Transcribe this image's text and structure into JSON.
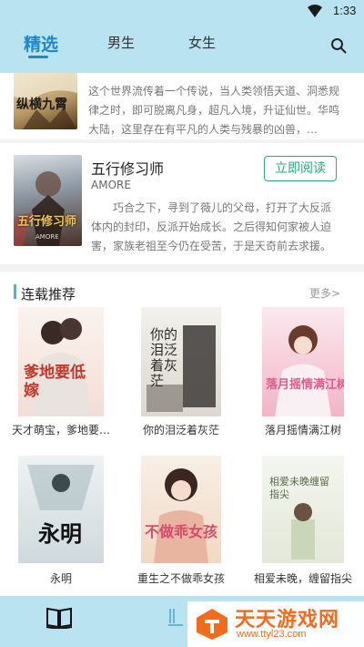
{
  "status": {
    "time": "1:33"
  },
  "tabs": [
    {
      "label": "精选"
    },
    {
      "label": "男生"
    },
    {
      "label": "女生"
    }
  ],
  "featured": [
    {
      "cover_text": "纵横九霄",
      "description": "这个世界流传着一个传说，当人类领悟天道、洞悉规律之时，即可脱离凡身，超凡入境，升证仙世。华鸣大陆，这里存在有平凡的人类与残暴的凶兽，…"
    },
    {
      "cover_text": "五行修习师",
      "cover_sub": "AMORE",
      "title": "五行修习师",
      "author": "AMORE",
      "description": "巧合之下，寻到了薇儿的父母，打开了大反派体内的封印，反派开始成长。之后得知何家被人迫害，家族老祖至今仍在受苦，于是天奇前去求援。",
      "button": "立即阅读"
    }
  ],
  "section": {
    "title": "连载推荐",
    "more": "更多>"
  },
  "grid": [
    {
      "title": "天才萌宝，爹地要…",
      "cover_text": "爹地要低嫁"
    },
    {
      "title": "你的泪泛着灰茫",
      "cover_text": "你的泪泛着灰茫"
    },
    {
      "title": "落月摇情满江树",
      "cover_text": "落月摇情满江树"
    },
    {
      "title": "永明",
      "cover_text": "永明"
    },
    {
      "title": "重生之不做乖女孩",
      "cover_text": "不做乖女孩"
    },
    {
      "title": "相爱未晚，缠留指尖",
      "cover_text": "相爱未晚缠留指尖"
    }
  ],
  "watermark": {
    "name": "天天游戏网",
    "url": "www.ttyl23.com"
  },
  "colors": {
    "header_bg": "#b9e3f1",
    "accent": "#1e88c8",
    "button": "#28a87d",
    "section_bar": "#3cc0c8"
  },
  "icons": {
    "search": "search-icon",
    "wifi": "wifi-icon",
    "book": "book-icon"
  }
}
